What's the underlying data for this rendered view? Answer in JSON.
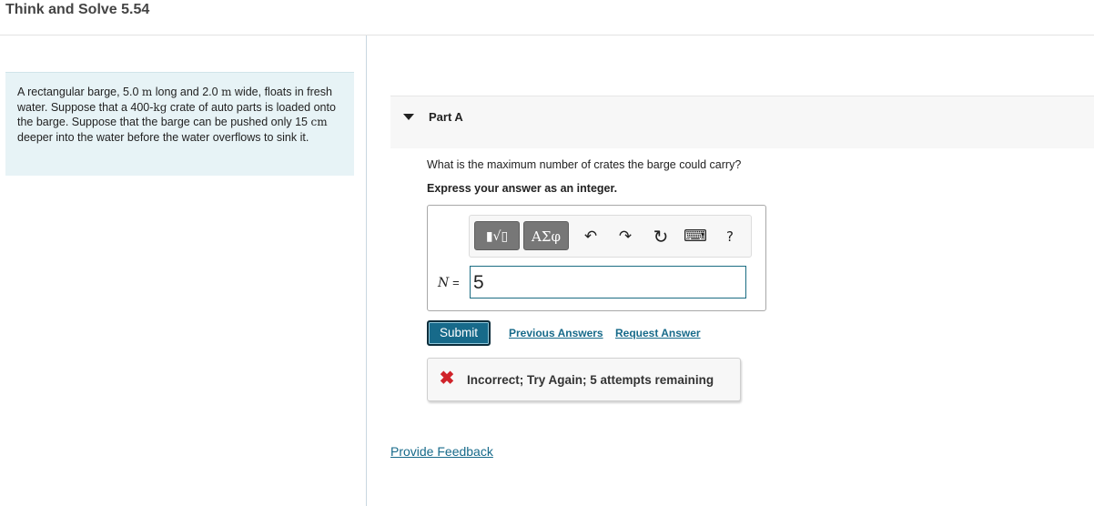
{
  "header": {
    "title": "Think and Solve 5.54"
  },
  "problem": {
    "segments": [
      {
        "t": "A rectangular barge, 5.0 "
      },
      {
        "u": "m"
      },
      {
        "t": " long and 2.0 "
      },
      {
        "u": "m"
      },
      {
        "t": " wide, floats in fresh water. Suppose that a 400-"
      },
      {
        "u": "kg"
      },
      {
        "t": " crate of auto parts is loaded onto the barge. Suppose that the barge can be pushed only 15 "
      },
      {
        "u": "cm"
      },
      {
        "t": " deeper into the water before the water overflows to sink it."
      }
    ]
  },
  "part": {
    "label": "Part A",
    "question": "What is the maximum number of crates the barge could carry?",
    "instruction": "Express your answer as an integer."
  },
  "toolbar": {
    "templates_glyph": "▮√▯",
    "symbols_label": "ΑΣφ",
    "undo_glyph": "↶",
    "redo_glyph": "↷",
    "reset_glyph": "↻",
    "keyboard_glyph": "⌨",
    "help_label": "?"
  },
  "answer": {
    "variable": "N",
    "equals": "=",
    "value": "5"
  },
  "actions": {
    "submit_label": "Submit",
    "previous_answers": "Previous Answers",
    "request_answer": "Request Answer"
  },
  "feedback": {
    "icon": "x-icon",
    "glyph": "✖",
    "message": "Incorrect; Try Again; 5 attempts remaining"
  },
  "footer": {
    "provide_feedback": "Provide Feedback"
  },
  "colors": {
    "accent": "#176a8a",
    "problem_bg": "#e7f3f6",
    "error": "#d0232a",
    "tool_button": "#777777"
  }
}
